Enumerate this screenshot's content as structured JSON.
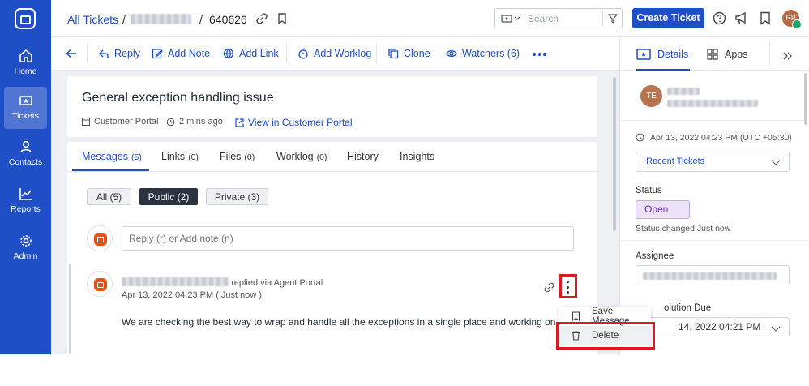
{
  "nav": {
    "items": [
      {
        "label": "Home",
        "icon": "home-icon"
      },
      {
        "label": "Tickets",
        "icon": "ticket-icon"
      },
      {
        "label": "Contacts",
        "icon": "contacts-icon"
      },
      {
        "label": "Reports",
        "icon": "reports-icon"
      },
      {
        "label": "Admin",
        "icon": "gear-icon"
      }
    ]
  },
  "topbar": {
    "breadcrumb_root": "All Tickets",
    "breadcrumb_sep": "/",
    "ticket_id": "640626",
    "search_placeholder": "Search",
    "create_button": "Create Ticket",
    "avatar_initials": "RP"
  },
  "toolbar": {
    "reply": "Reply",
    "add_note": "Add Note",
    "add_link": "Add Link",
    "add_worklog": "Add Worklog",
    "clone": "Clone",
    "watchers": "Watchers (6)"
  },
  "ticket": {
    "title": "General exception handling issue",
    "source": "Customer Portal",
    "age": "2 mins ago",
    "view_link": "View in Customer Portal"
  },
  "tabs": [
    {
      "label": "Messages",
      "count": "(5)"
    },
    {
      "label": "Links",
      "count": "(0)"
    },
    {
      "label": "Files",
      "count": "(0)"
    },
    {
      "label": "Worklog",
      "count": "(0)"
    },
    {
      "label": "History",
      "count": ""
    },
    {
      "label": "Insights",
      "count": ""
    }
  ],
  "filters": [
    "All (5)",
    "Public (2)",
    "Private (3)"
  ],
  "reply_placeholder": "Reply (r) or Add note (n)",
  "message": {
    "via": "replied via Agent Portal",
    "timestamp": "Apr 13, 2022 04:23 PM ( Just now )",
    "body": "We are checking the best way to wrap and handle all the exceptions in a single place and working on it."
  },
  "menu": {
    "save": "Save Message",
    "delete": "Delete"
  },
  "details": {
    "tab_details": "Details",
    "tab_apps": "Apps",
    "contact_initials": "TE",
    "created": "Apr 13, 2022 04:23 PM (UTC +05:30)",
    "recent_tickets": "Recent Tickets",
    "status_label": "Status",
    "status_value": "Open",
    "status_changed": "Status changed Just now",
    "assignee_label": "Assignee",
    "due_label": "Resolution Due",
    "due_label_visible": "olution Due",
    "due_value": "14, 2022 04:21 PM"
  },
  "colors": {
    "brand": "#1f4fc6",
    "highlight": "#e0171e",
    "status_open": "#6a2bb5"
  }
}
